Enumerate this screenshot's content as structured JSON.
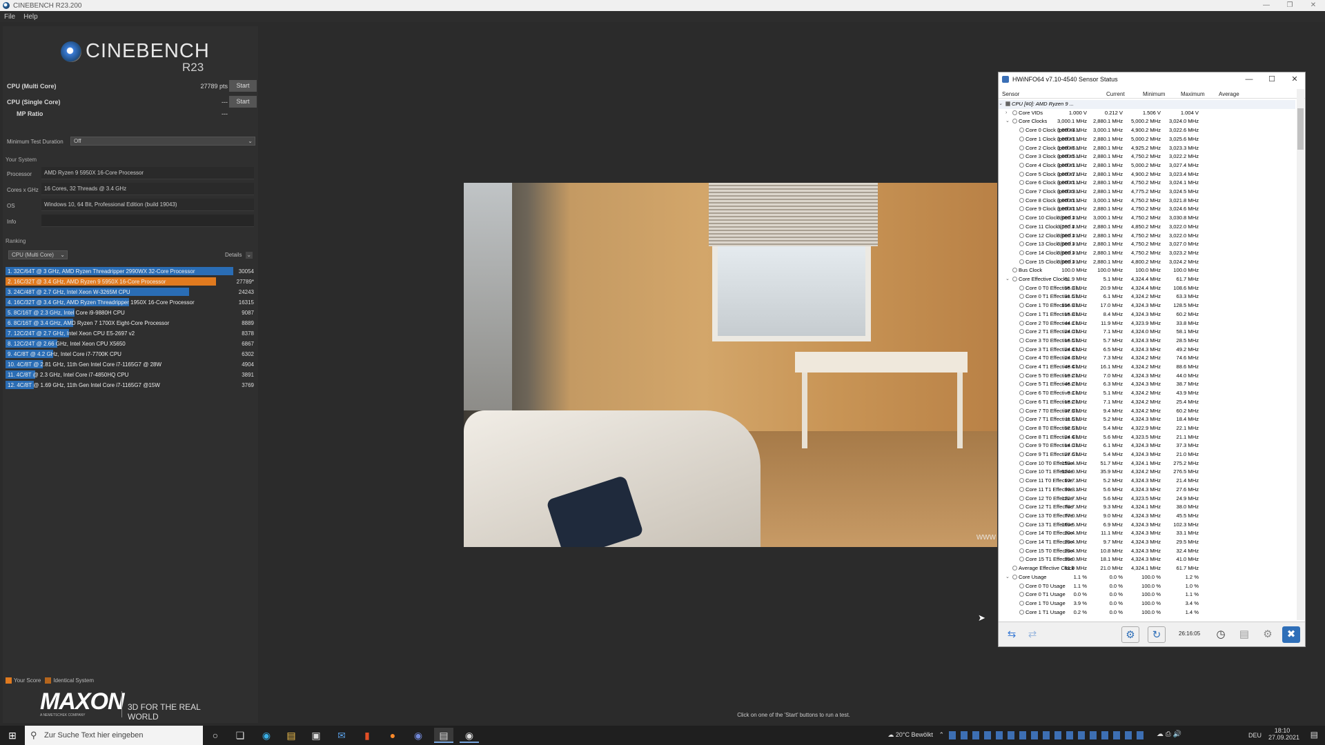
{
  "window": {
    "title": "CINEBENCH R23.200"
  },
  "menu": [
    "File",
    "Help"
  ],
  "logo": {
    "name": "CINEBENCH",
    "version": "R23"
  },
  "tests": {
    "multi": {
      "label": "CPU (Multi Core)",
      "value": "27789 pts",
      "button": "Start"
    },
    "single": {
      "label": "CPU (Single Core)",
      "value": "---",
      "button": "Start"
    },
    "mp": {
      "label": "MP Ratio",
      "value": "---"
    }
  },
  "min_duration": {
    "label": "Minimum Test Duration",
    "value": "Off"
  },
  "system": {
    "section": "Your System",
    "rows": [
      {
        "label": "Processor",
        "value": "AMD Ryzen 9 5950X 16-Core Processor"
      },
      {
        "label": "Cores x GHz",
        "value": "16 Cores, 32 Threads @ 3.4 GHz"
      },
      {
        "label": "OS",
        "value": "Windows 10, 64 Bit, Professional Edition (build 19043)"
      },
      {
        "label": "Info",
        "value": ""
      }
    ]
  },
  "ranking": {
    "section": "Ranking",
    "dropdown": "CPU (Multi Core)",
    "details": "Details",
    "items": [
      {
        "label": "1. 32C/64T @ 3 GHz, AMD Ryzen Threadripper 2990WX 32-Core Processor",
        "score": "30054",
        "fraction": 1.0,
        "color": "#2a6db5"
      },
      {
        "label": "2. 16C/32T @ 3.4 GHz, AMD Ryzen 9 5950X 16-Core Processor",
        "score": "27789*",
        "fraction": 0.925,
        "color": "#e07a1f"
      },
      {
        "label": "3. 24C/48T @ 2.7 GHz, Intel Xeon W-3265M CPU",
        "score": "24243",
        "fraction": 0.807,
        "color": "#2a6db5"
      },
      {
        "label": "4. 16C/32T @ 3.4 GHz, AMD Ryzen Threadripper 1950X 16-Core Processor",
        "score": "16315",
        "fraction": 0.543,
        "color": "#2a6db5"
      },
      {
        "label": "5. 8C/16T @ 2.3 GHz, Intel Core i9-9880H CPU",
        "score": "9087",
        "fraction": 0.302,
        "color": "#2a6db5"
      },
      {
        "label": "6. 8C/16T @ 3.4 GHz, AMD Ryzen 7 1700X Eight-Core Processor",
        "score": "8889",
        "fraction": 0.296,
        "color": "#2a6db5"
      },
      {
        "label": "7. 12C/24T @ 2.7 GHz, Intel Xeon CPU E5-2697 v2",
        "score": "8378",
        "fraction": 0.279,
        "color": "#2a6db5"
      },
      {
        "label": "8. 12C/24T @ 2.66 GHz, Intel Xeon CPU X5650",
        "score": "6867",
        "fraction": 0.228,
        "color": "#2a6db5"
      },
      {
        "label": "9. 4C/8T @ 4.2 GHz, Intel Core i7-7700K CPU",
        "score": "6302",
        "fraction": 0.21,
        "color": "#2a6db5"
      },
      {
        "label": "10. 4C/8T @ 2.81 GHz, 11th Gen Intel Core i7-1165G7 @ 28W",
        "score": "4904",
        "fraction": 0.163,
        "color": "#2a6db5"
      },
      {
        "label": "11. 4C/8T @ 2.3 GHz, Intel Core i7-4850HQ CPU",
        "score": "3891",
        "fraction": 0.129,
        "color": "#2a6db5"
      },
      {
        "label": "12. 4C/8T @ 1.69 GHz, 11th Gen Intel Core i7-1165G7 @15W",
        "score": "3769",
        "fraction": 0.125,
        "color": "#2a6db5"
      }
    ]
  },
  "legend": {
    "your_score": "Your Score",
    "identical": "Identical System",
    "your_color": "#e07a1f",
    "identical_color": "#b5651d"
  },
  "maxon": {
    "brand": "MAXON",
    "sub": "A NEMETSCHEK COMPANY",
    "tagline": "3D FOR THE REAL WORLD"
  },
  "render": {
    "watermark": "www"
  },
  "status_text": "Click on one of the 'Start' buttons to run a test.",
  "hwinfo": {
    "title": "HWiNFO64 v7.10-4540 Sensor Status",
    "columns": [
      "Sensor",
      "Current",
      "Minimum",
      "Maximum",
      "Average"
    ],
    "timer": "26:16:05",
    "rows": [
      {
        "level": 0,
        "exp": "v",
        "name": "CPU [#0]: AMD Ryzen 9 ...",
        "cur": "",
        "min": "",
        "max": "",
        "avg": "",
        "header": true
      },
      {
        "level": 1,
        "exp": ">",
        "name": "Core VIDs",
        "cur": "1.000 V",
        "min": "0.212 V",
        "max": "1.506 V",
        "avg": "1.004 V"
      },
      {
        "level": 1,
        "exp": "v",
        "name": "Core Clocks",
        "cur": "3,000.1 MHz",
        "min": "2,880.1 MHz",
        "max": "5,000.2 MHz",
        "avg": "3,024.0 MHz"
      },
      {
        "level": 2,
        "name": "Core 0 Clock (perf #4...",
        "cur": "3,000.1 MHz",
        "min": "3,000.1 MHz",
        "max": "4,900.2 MHz",
        "avg": "3,022.6 MHz"
      },
      {
        "level": 2,
        "name": "Core 1 Clock (perf #1...",
        "cur": "3,000.1 MHz",
        "min": "2,880.1 MHz",
        "max": "5,000.2 MHz",
        "avg": "3,025.6 MHz"
      },
      {
        "level": 2,
        "name": "Core 2 Clock (perf #6...",
        "cur": "3,000.1 MHz",
        "min": "2,880.1 MHz",
        "max": "4,925.2 MHz",
        "avg": "3,023.3 MHz"
      },
      {
        "level": 2,
        "name": "Core 3 Clock (perf #5...",
        "cur": "3,000.1 MHz",
        "min": "2,880.1 MHz",
        "max": "4,750.2 MHz",
        "avg": "3,022.2 MHz"
      },
      {
        "level": 2,
        "name": "Core 4 Clock (perf #1...",
        "cur": "3,000.1 MHz",
        "min": "2,880.1 MHz",
        "max": "5,000.2 MHz",
        "avg": "3,027.4 MHz"
      },
      {
        "level": 2,
        "name": "Core 5 Clock (perf #7...",
        "cur": "3,000.1 MHz",
        "min": "2,880.1 MHz",
        "max": "4,900.2 MHz",
        "avg": "3,023.4 MHz"
      },
      {
        "level": 2,
        "name": "Core 6 Clock (perf #1...",
        "cur": "3,000.1 MHz",
        "min": "2,880.1 MHz",
        "max": "4,750.2 MHz",
        "avg": "3,024.1 MHz"
      },
      {
        "level": 2,
        "name": "Core 7 Clock (perf #3...",
        "cur": "3,000.1 MHz",
        "min": "2,880.1 MHz",
        "max": "4,775.2 MHz",
        "avg": "3,024.5 MHz"
      },
      {
        "level": 2,
        "name": "Core 8 Clock (perf #1...",
        "cur": "3,000.1 MHz",
        "min": "3,000.1 MHz",
        "max": "4,750.2 MHz",
        "avg": "3,021.8 MHz"
      },
      {
        "level": 2,
        "name": "Core 9 Clock (perf #1...",
        "cur": "3,000.1 MHz",
        "min": "2,880.1 MHz",
        "max": "4,750.2 MHz",
        "avg": "3,024.6 MHz"
      },
      {
        "level": 2,
        "name": "Core 10 Clock (perf #...",
        "cur": "3,000.1 MHz",
        "min": "3,000.1 MHz",
        "max": "4,750.2 MHz",
        "avg": "3,030.8 MHz"
      },
      {
        "level": 2,
        "name": "Core 11 Clock (perf #...",
        "cur": "3,000.1 MHz",
        "min": "2,880.1 MHz",
        "max": "4,850.2 MHz",
        "avg": "3,022.0 MHz"
      },
      {
        "level": 2,
        "name": "Core 12 Clock (perf #...",
        "cur": "3,000.1 MHz",
        "min": "2,880.1 MHz",
        "max": "4,750.2 MHz",
        "avg": "3,022.0 MHz"
      },
      {
        "level": 2,
        "name": "Core 13 Clock (perf #...",
        "cur": "3,000.1 MHz",
        "min": "2,880.1 MHz",
        "max": "4,750.2 MHz",
        "avg": "3,027.0 MHz"
      },
      {
        "level": 2,
        "name": "Core 14 Clock (perf #...",
        "cur": "3,000.1 MHz",
        "min": "2,880.1 MHz",
        "max": "4,750.2 MHz",
        "avg": "3,023.2 MHz"
      },
      {
        "level": 2,
        "name": "Core 15 Clock (perf #...",
        "cur": "3,000.1 MHz",
        "min": "2,880.1 MHz",
        "max": "4,800.2 MHz",
        "avg": "3,024.2 MHz"
      },
      {
        "level": 1,
        "name": "Bus Clock",
        "cur": "100.0 MHz",
        "min": "100.0 MHz",
        "max": "100.0 MHz",
        "avg": "100.0 MHz"
      },
      {
        "level": 1,
        "exp": "v",
        "name": "Core Effective Clocks",
        "cur": "61.9 MHz",
        "min": "5.1 MHz",
        "max": "4,324.4 MHz",
        "avg": "61.7 MHz"
      },
      {
        "level": 2,
        "name": "Core 0 T0 Effective Cl...",
        "cur": "55.3 MHz",
        "min": "20.9 MHz",
        "max": "4,324.4 MHz",
        "avg": "108.6 MHz"
      },
      {
        "level": 2,
        "name": "Core 0 T1 Effective Cl...",
        "cur": "31.5 MHz",
        "min": "6.1 MHz",
        "max": "4,324.2 MHz",
        "avg": "63.3 MHz"
      },
      {
        "level": 2,
        "name": "Core 1 T0 Effective Cl...",
        "cur": "156.9 MHz",
        "min": "17.0 MHz",
        "max": "4,324.3 MHz",
        "avg": "128.5 MHz"
      },
      {
        "level": 2,
        "name": "Core 1 T1 Effective Cl...",
        "cur": "15.8 MHz",
        "min": "8.4 MHz",
        "max": "4,324.3 MHz",
        "avg": "60.2 MHz"
      },
      {
        "level": 2,
        "name": "Core 2 T0 Effective Cl...",
        "cur": "44.1 MHz",
        "min": "11.9 MHz",
        "max": "4,323.9 MHz",
        "avg": "33.8 MHz"
      },
      {
        "level": 2,
        "name": "Core 2 T1 Effective Cl...",
        "cur": "24.0 MHz",
        "min": "7.1 MHz",
        "max": "4,324.0 MHz",
        "avg": "58.1 MHz"
      },
      {
        "level": 2,
        "name": "Core 3 T0 Effective Cl...",
        "cur": "16.5 MHz",
        "min": "5.7 MHz",
        "max": "4,324.3 MHz",
        "avg": "28.5 MHz"
      },
      {
        "level": 2,
        "name": "Core 3 T1 Effective Cl...",
        "cur": "24.4 MHz",
        "min": "6.5 MHz",
        "max": "4,324.3 MHz",
        "avg": "49.2 MHz"
      },
      {
        "level": 2,
        "name": "Core 4 T0 Effective Cl...",
        "cur": "24.3 MHz",
        "min": "7.3 MHz",
        "max": "4,324.2 MHz",
        "avg": "74.6 MHz"
      },
      {
        "level": 2,
        "name": "Core 4 T1 Effective Cl...",
        "cur": "48.4 MHz",
        "min": "16.1 MHz",
        "max": "4,324.2 MHz",
        "avg": "88.6 MHz"
      },
      {
        "level": 2,
        "name": "Core 5 T0 Effective Cl...",
        "cur": "19.2 MHz",
        "min": "7.0 MHz",
        "max": "4,324.3 MHz",
        "avg": "44.0 MHz"
      },
      {
        "level": 2,
        "name": "Core 5 T1 Effective Cl...",
        "cur": "46.2 MHz",
        "min": "6.3 MHz",
        "max": "4,324.3 MHz",
        "avg": "38.7 MHz"
      },
      {
        "level": 2,
        "name": "Core 6 T0 Effective Cl...",
        "cur": "9.1 MHz",
        "min": "5.1 MHz",
        "max": "4,324.2 MHz",
        "avg": "43.9 MHz"
      },
      {
        "level": 2,
        "name": "Core 6 T1 Effective Cl...",
        "cur": "18.2 MHz",
        "min": "7.1 MHz",
        "max": "4,324.2 MHz",
        "avg": "25.4 MHz"
      },
      {
        "level": 2,
        "name": "Core 7 T0 Effective Cl...",
        "cur": "37.9 MHz",
        "min": "9.4 MHz",
        "max": "4,324.2 MHz",
        "avg": "60.2 MHz"
      },
      {
        "level": 2,
        "name": "Core 7 T1 Effective Cl...",
        "cur": "11.5 MHz",
        "min": "5.2 MHz",
        "max": "4,324.3 MHz",
        "avg": "18.4 MHz"
      },
      {
        "level": 2,
        "name": "Core 8 T0 Effective Cl...",
        "cur": "52.5 MHz",
        "min": "5.4 MHz",
        "max": "4,322.9 MHz",
        "avg": "22.1 MHz"
      },
      {
        "level": 2,
        "name": "Core 8 T1 Effective Cl...",
        "cur": "24.4 MHz",
        "min": "5.6 MHz",
        "max": "4,323.5 MHz",
        "avg": "21.1 MHz"
      },
      {
        "level": 2,
        "name": "Core 9 T0 Effective Cl...",
        "cur": "14.0 MHz",
        "min": "6.1 MHz",
        "max": "4,324.3 MHz",
        "avg": "37.3 MHz"
      },
      {
        "level": 2,
        "name": "Core 9 T1 Effective Cl...",
        "cur": "27.6 MHz",
        "min": "5.4 MHz",
        "max": "4,324.3 MHz",
        "avg": "21.0 MHz"
      },
      {
        "level": 2,
        "name": "Core 10 T0 Effective ...",
        "cur": "153.4 MHz",
        "min": "51.7 MHz",
        "max": "4,324.1 MHz",
        "avg": "275.2 MHz"
      },
      {
        "level": 2,
        "name": "Core 10 T1 Effective ...",
        "cur": "524.0 MHz",
        "min": "35.9 MHz",
        "max": "4,324.2 MHz",
        "avg": "276.5 MHz"
      },
      {
        "level": 2,
        "name": "Core 11 T0 Effective ...",
        "cur": "10.7 MHz",
        "min": "5.2 MHz",
        "max": "4,324.3 MHz",
        "avg": "21.4 MHz"
      },
      {
        "level": 2,
        "name": "Core 11 T1 Effective ...",
        "cur": "36.3 MHz",
        "min": "5.6 MHz",
        "max": "4,324.3 MHz",
        "avg": "27.6 MHz"
      },
      {
        "level": 2,
        "name": "Core 12 T0 Effective ...",
        "cur": "122.7 MHz",
        "min": "5.6 MHz",
        "max": "4,323.5 MHz",
        "avg": "24.9 MHz"
      },
      {
        "level": 2,
        "name": "Core 12 T1 Effective ...",
        "cur": "78.7 MHz",
        "min": "9.3 MHz",
        "max": "4,324.1 MHz",
        "avg": "38.0 MHz"
      },
      {
        "level": 2,
        "name": "Core 13 T0 Effective ...",
        "cur": "77.0 MHz",
        "min": "9.0 MHz",
        "max": "4,324.3 MHz",
        "avg": "45.5 MHz"
      },
      {
        "level": 2,
        "name": "Core 13 T1 Effective ...",
        "cur": "169.5 MHz",
        "min": "6.9 MHz",
        "max": "4,324.3 MHz",
        "avg": "102.3 MHz"
      },
      {
        "level": 2,
        "name": "Core 14 T0 Effective ...",
        "cur": "20.4 MHz",
        "min": "11.1 MHz",
        "max": "4,324.3 MHz",
        "avg": "33.1 MHz"
      },
      {
        "level": 2,
        "name": "Core 14 T1 Effective ...",
        "cur": "25.4 MHz",
        "min": "9.7 MHz",
        "max": "4,324.3 MHz",
        "avg": "29.5 MHz"
      },
      {
        "level": 2,
        "name": "Core 15 T0 Effective ...",
        "cur": "25.4 MHz",
        "min": "10.8 MHz",
        "max": "4,324.3 MHz",
        "avg": "32.4 MHz"
      },
      {
        "level": 2,
        "name": "Core 15 T1 Effective ...",
        "cur": "35.0 MHz",
        "min": "18.1 MHz",
        "max": "4,324.3 MHz",
        "avg": "41.0 MHz"
      },
      {
        "level": 1,
        "name": "Average Effective Clock",
        "cur": "61.9 MHz",
        "min": "21.0 MHz",
        "max": "4,324.1 MHz",
        "avg": "61.7 MHz"
      },
      {
        "level": 1,
        "exp": "v",
        "name": "Core Usage",
        "cur": "1.1 %",
        "min": "0.0 %",
        "max": "100.0 %",
        "avg": "1.2 %"
      },
      {
        "level": 2,
        "name": "Core 0 T0 Usage",
        "cur": "1.1 %",
        "min": "0.0 %",
        "max": "100.0 %",
        "avg": "1.0 %"
      },
      {
        "level": 2,
        "name": "Core 0 T1 Usage",
        "cur": "0.0 %",
        "min": "0.0 %",
        "max": "100.0 %",
        "avg": "1.1 %"
      },
      {
        "level": 2,
        "name": "Core 1 T0 Usage",
        "cur": "3.9 %",
        "min": "0.0 %",
        "max": "100.0 %",
        "avg": "3.4 %"
      },
      {
        "level": 2,
        "name": "Core 1 T1 Usage",
        "cur": "0.2 %",
        "min": "0.0 %",
        "max": "100.0 %",
        "avg": "1.4 %"
      }
    ]
  },
  "taskbar": {
    "search_placeholder": "Zur Suche Text hier eingeben",
    "weather": "20°C  Bewölkt",
    "lang": "DEU",
    "time": "18:10",
    "date": "27.09.2021"
  }
}
